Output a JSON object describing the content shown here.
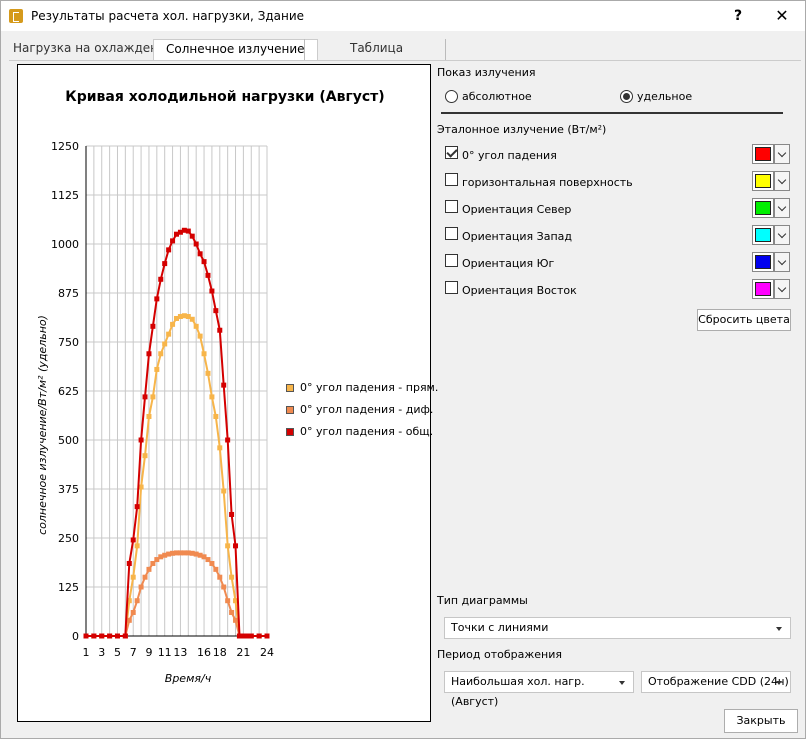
{
  "window": {
    "title": "Результаты расчета хол. нагрузки, Здание",
    "help_label": "?",
    "close_label": "✕"
  },
  "tabs": [
    {
      "label": "Нагрузка на охлаждение",
      "active": false
    },
    {
      "label": "Солнечное излучение",
      "active": true
    },
    {
      "label": "Таблица",
      "active": false
    }
  ],
  "chart_data": {
    "type": "line",
    "title": "Кривая холодильной нагрузки (Август)",
    "xlabel": "Время/ч",
    "ylabel": "солнечное излучение/Вт/м² (удельно)",
    "xlim": [
      1,
      24
    ],
    "ylim": [
      0,
      1250
    ],
    "x_ticks": [
      1,
      3,
      5,
      7,
      9,
      11,
      13,
      16,
      18,
      21,
      24
    ],
    "y_ticks": [
      0,
      125,
      250,
      375,
      500,
      625,
      750,
      875,
      1000,
      1125,
      1250
    ],
    "grid": true,
    "legend_position": "right",
    "series": [
      {
        "name": "0° угол падения - прям.",
        "color": "#f7b54a",
        "x": [
          1,
          2,
          3,
          4,
          5,
          6,
          6.5,
          7,
          7.5,
          8,
          8.5,
          9,
          9.5,
          10,
          10.5,
          11,
          11.5,
          12,
          12.5,
          13,
          13.5,
          14,
          14.5,
          15,
          15.5,
          16,
          16.5,
          17,
          17.5,
          18,
          18.5,
          19,
          19.5,
          20,
          20.5,
          21,
          21.5,
          22,
          23,
          24
        ],
        "y": [
          0,
          0,
          0,
          0,
          0,
          0,
          90,
          150,
          230,
          380,
          460,
          560,
          610,
          680,
          720,
          745,
          770,
          795,
          810,
          815,
          817,
          815,
          808,
          790,
          765,
          720,
          670,
          610,
          560,
          480,
          370,
          230,
          150,
          90,
          0,
          0,
          0,
          0,
          0,
          0
        ]
      },
      {
        "name": "0° угол падения - диф.",
        "color": "#f08a50",
        "x": [
          1,
          2,
          3,
          4,
          5,
          6,
          6.5,
          7,
          7.5,
          8,
          8.5,
          9,
          9.5,
          10,
          10.5,
          11,
          11.5,
          12,
          12.5,
          13,
          13.5,
          14,
          14.5,
          15,
          15.5,
          16,
          16.5,
          17,
          17.5,
          18,
          18.5,
          19,
          19.5,
          20,
          20.5,
          21,
          21.5,
          22,
          23,
          24
        ],
        "y": [
          0,
          0,
          0,
          0,
          0,
          0,
          40,
          60,
          90,
          125,
          150,
          170,
          185,
          195,
          202,
          206,
          209,
          211,
          212,
          212,
          212,
          212,
          211,
          209,
          206,
          202,
          195,
          185,
          170,
          150,
          125,
          90,
          60,
          40,
          0,
          0,
          0,
          0,
          0,
          0
        ]
      },
      {
        "name": "0° угол падения - общ.",
        "color": "#d40000",
        "x": [
          1,
          2,
          3,
          4,
          5,
          6,
          6.5,
          7,
          7.5,
          8,
          8.5,
          9,
          9.5,
          10,
          10.5,
          11,
          11.5,
          12,
          12.5,
          13,
          13.5,
          14,
          14.5,
          15,
          15.5,
          16,
          16.5,
          17,
          17.5,
          18,
          18.5,
          19,
          19.5,
          20,
          20.5,
          21,
          21.5,
          22,
          23,
          24
        ],
        "y": [
          0,
          0,
          0,
          0,
          0,
          0,
          185,
          245,
          330,
          500,
          610,
          720,
          790,
          860,
          910,
          950,
          985,
          1008,
          1025,
          1030,
          1035,
          1033,
          1020,
          1000,
          975,
          955,
          920,
          880,
          830,
          780,
          640,
          500,
          310,
          230,
          0,
          0,
          0,
          0,
          0,
          0
        ]
      }
    ]
  },
  "radiation_display": {
    "label": "Показ излучения",
    "options": [
      {
        "label": "абсолютное",
        "checked": false
      },
      {
        "label": "удельное",
        "checked": true
      }
    ]
  },
  "reference": {
    "label": "Эталонное излучение (Вт/м²)",
    "items": [
      {
        "label": "0° угол падения",
        "checked": true,
        "color": "#ff0000"
      },
      {
        "label": "горизонтальная поверхность",
        "checked": false,
        "color": "#ffff00"
      },
      {
        "label": "Ориентация Север",
        "checked": false,
        "color": "#00ee00"
      },
      {
        "label": "Ориентация Запад",
        "checked": false,
        "color": "#00ffff"
      },
      {
        "label": "Ориентация Юг",
        "checked": false,
        "color": "#0000ee"
      },
      {
        "label": "Ориентация Восток",
        "checked": false,
        "color": "#ff00ff"
      }
    ],
    "reset_label": "Сбросить цвета"
  },
  "diagram_type": {
    "label": "Тип диаграммы",
    "value": "Точки с линиями"
  },
  "period": {
    "label": "Период отображения",
    "value1": "Наибольшая хол. нагр. (Август)",
    "value2": "Отображение CDD (24ч)"
  },
  "close_button_label": "Закрыть"
}
